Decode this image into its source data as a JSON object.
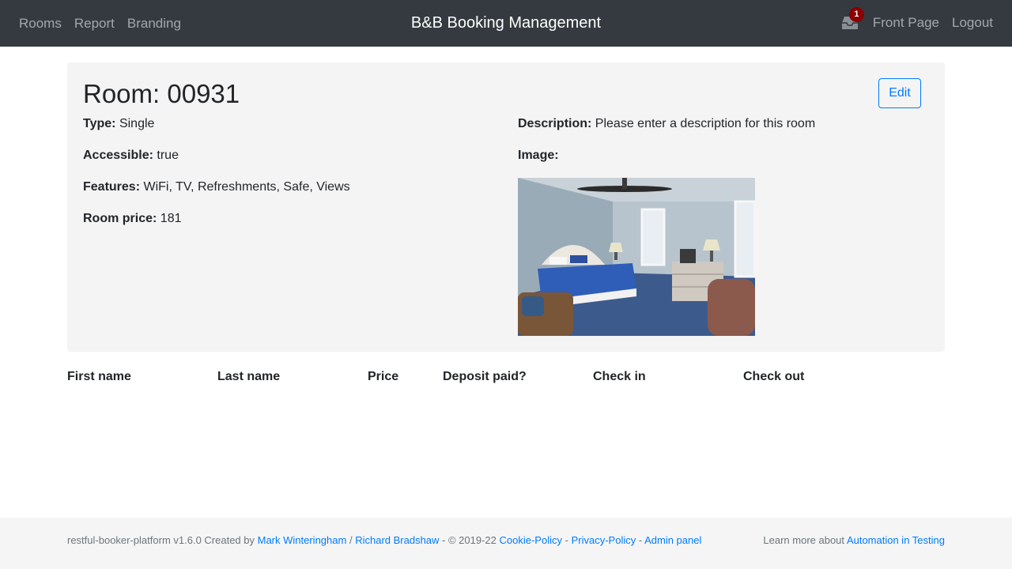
{
  "nav": {
    "left_links": [
      "Rooms",
      "Report",
      "Branding"
    ],
    "brand": "B&B Booking Management",
    "notification_count": "1",
    "front_page": "Front Page",
    "logout": "Logout"
  },
  "room": {
    "title": "Room: 00931",
    "edit_label": "Edit",
    "type_label": "Type:",
    "type_value": "Single",
    "accessible_label": "Accessible:",
    "accessible_value": "true",
    "features_label": "Features:",
    "features_value": "WiFi, TV, Refreshments, Safe, Views",
    "price_label": "Room price:",
    "price_value": "181",
    "description_label": "Description:",
    "description_value": "Please enter a description for this room",
    "image_label": "Image:"
  },
  "bookings": {
    "headers": [
      "First name",
      "Last name",
      "Price",
      "Deposit paid?",
      "Check in",
      "Check out"
    ]
  },
  "footer": {
    "prefix": "restful-booker-platform v1.6.0 Created by",
    "author1": "Mark Winteringham",
    "sep1": "/",
    "author2": "Richard Bradshaw",
    "copyright": "- © 2019-22",
    "cookie": "Cookie-Policy",
    "dash1": "-",
    "privacy": "Privacy-Policy",
    "dash2": "-",
    "admin": "Admin panel",
    "learn": "Learn more about",
    "ait": "Automation in Testing"
  },
  "colors": {
    "navbar": "#343a40",
    "link": "#007bff",
    "card": "#f4f4f4",
    "badge": "#8b0000"
  }
}
